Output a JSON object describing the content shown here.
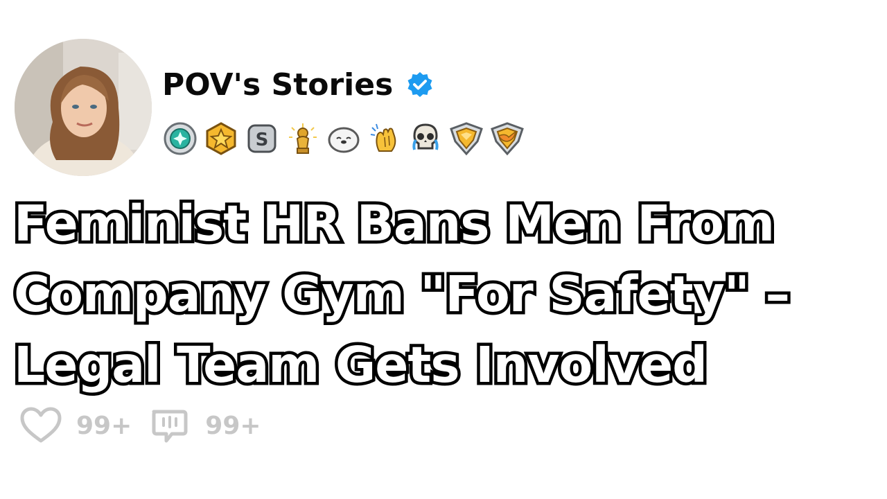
{
  "post": {
    "author_name": "POV's Stories",
    "verified_icon": "verified-check-icon",
    "accent_color": "#1d9bf0",
    "badges": [
      "teal-gem-badge-icon",
      "gold-star-badge-icon",
      "silver-s-badge-icon",
      "gold-trophy-badge-icon",
      "seal-emoji-badge-icon",
      "clapping-hands-badge-icon",
      "crying-skull-badge-icon",
      "gold-diamond-chevron-badge-icon",
      "gold-wings-chevron-badge-icon"
    ],
    "headline": "Feminist HR Bans Men From\nCompany Gym \"For Safety\" –\nLegal Team Gets Involved",
    "likes_count": "99+",
    "comments_count": "99+"
  }
}
